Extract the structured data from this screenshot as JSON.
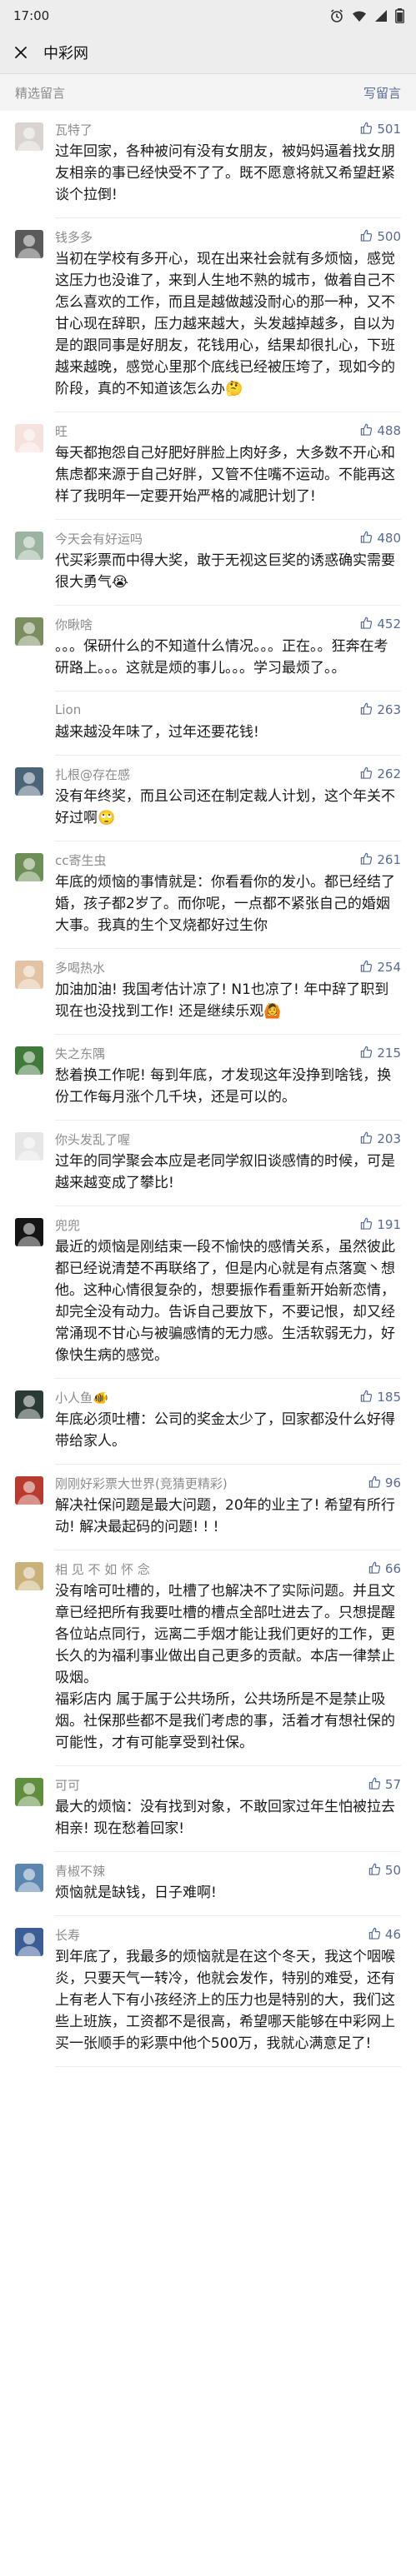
{
  "status_bar": {
    "time": "17:00"
  },
  "nav": {
    "title": "中彩网"
  },
  "section": {
    "title": "精选留言",
    "write_label": "写留言"
  },
  "colors": {
    "link": "#576b95",
    "nickname": "#8c8c8c",
    "background_header": "#ededed"
  },
  "comments": [
    {
      "nickname": "瓦特了",
      "likes": "501",
      "avatar_icon": "cartoon-face-icon",
      "avatar_color": "#d9d4cf",
      "text": "过年回家，各种被问有没有女朋友，被妈妈逼着找女朋友相亲的事已经快受不了了。既不愿意将就又希望赶紧谈个拉倒!"
    },
    {
      "nickname": "钱多多",
      "likes": "500",
      "avatar_icon": "cat-icon",
      "avatar_color": "#5a5a5a",
      "text": "当初在学校有多开心，现在出来社会就有多烦恼，感觉这压力也没谁了，来到人生地不熟的城市，做着自己不怎么喜欢的工作，而且是越做越没耐心的那一种，又不甘心现在辞职，压力越来越大，头发越掉越多，自以为是的跟同事是好朋友，花钱用心，结果却很扎心，下班越来越晚，感觉心里那个底线已经被压垮了，现如今的阶段，真的不知道该怎么办🤔"
    },
    {
      "nickname": "旺",
      "likes": "488",
      "avatar_icon": "maple-leaf-icon",
      "avatar_color": "#f6e2dc",
      "text": "每天都抱怨自己好肥好胖脸上肉好多，大多数不开心和焦虑都来源于自己好胖，又管不住嘴不运动。不能再这样了我明年一定要开始严格的减肥计划了!"
    },
    {
      "nickname": "今天会有好运吗",
      "likes": "480",
      "avatar_icon": "portrait-icon",
      "avatar_color": "#9bb3a0",
      "text": "代买彩票而中得大奖，敢于无视这巨奖的诱惑确实需要很大勇气😭"
    },
    {
      "nickname": "你瞅啥",
      "likes": "452",
      "avatar_icon": "portrait-icon",
      "avatar_color": "#7b8e5f",
      "text": "。。。保研什么的不知道什么情况。。。正在。。狂奔在考研路上。。。这就是烦的事儿。。。学习最烦了。。"
    },
    {
      "nickname": "Lion",
      "likes": "263",
      "avatar_icon": "panda-icon",
      "avatar_color": "#ffffff",
      "text": "越来越没年味了，过年还要花钱!"
    },
    {
      "nickname": "扎根@存在感",
      "likes": "262",
      "avatar_icon": "landscape-icon",
      "avatar_color": "#4a6478",
      "text": "没有年终奖，而且公司还在制定裁人计划，这个年关不好过啊🙄"
    },
    {
      "nickname": "cc寄生虫",
      "likes": "261",
      "avatar_icon": "cartoon-icon",
      "avatar_color": "#6d8f55",
      "text": "年底的烦恼的事情就是：你看看你的发小。都已经结了婚，孩子都2岁了。而你呢，一点都不紧张自己的婚姻大事。我真的生个叉烧都好过生你"
    },
    {
      "nickname": "多喝热水",
      "likes": "254",
      "avatar_icon": "child-icon",
      "avatar_color": "#e3c3a4",
      "text": "加油加油! 我国考估计凉了! N1也凉了! 年中辞了职到现在也没找到工作! 还是继续乐观🙆"
    },
    {
      "nickname": "失之东隅",
      "likes": "215",
      "avatar_icon": "flower-icon",
      "avatar_color": "#3f7a3a",
      "text": "愁着换工作呢! 每到年底，才发现这年没挣到啥钱，换份工作每月涨个几千块，还是可以的。"
    },
    {
      "nickname": "你头发乱了喔",
      "likes": "203",
      "avatar_icon": "sketch-icon",
      "avatar_color": "#e6e6e6",
      "text": "过年的同学聚会本应是老同学叙旧谈感情的时候，可是越来越变成了攀比!"
    },
    {
      "nickname": "兜兜",
      "likes": "191",
      "avatar_icon": "dark-portrait-icon",
      "avatar_color": "#151515",
      "text": "最近的烦恼是刚结束一段不愉快的感情关系，虽然彼此都已经说清楚不再联络了，但是内心就是有点落寞丶想他。这种心情很复杂的，想要振作看重新开始新恋情，却完全没有动力。告诉自己要放下，不要记恨，却又经常涌现不甘心与被骗感情的无力感。生活软弱无力，好像快生病的感觉。"
    },
    {
      "nickname": "小人鱼🐠",
      "likes": "185",
      "avatar_icon": "mermaid-icon",
      "avatar_color": "#2b3a34",
      "text": "年底必须吐槽：公司的奖金太少了，回家都没什么好得带给家人。"
    },
    {
      "nickname": "刚刚好彩票大世界(竞猜更精彩)",
      "likes": "96",
      "avatar_icon": "shop-icon",
      "avatar_color": "#b93a2e",
      "text": "解决社保问题是最大问题，20年的业主了! 希望有所行动! 解决最起码的问题! ! !"
    },
    {
      "nickname": "相 见 不 如 怀 念",
      "likes": "66",
      "avatar_icon": "collage-icon",
      "avatar_color": "#c9b27a",
      "text": "没有啥可吐槽的，吐槽了也解决不了实际问题。并且文章已经把所有我要吐槽的槽点全部吐进去了。只想提醒各位站点同行，远离二手烟才能让我们更好的工作，更长久的为福利事业做出自己更多的贡献。本店一律禁止吸烟。\n福彩店内 属于属于公共场所，公共场所是不是禁止吸烟。社保那些都不是我们考虑的事，活着才有想社保的可能性，才有可能享受到社保。"
    },
    {
      "nickname": "可可",
      "likes": "57",
      "avatar_icon": "grass-icon",
      "avatar_color": "#5f8f3d",
      "text": "最大的烦恼：没有找到对象，不敢回家过年生怕被拉去相亲! 现在愁着回家!"
    },
    {
      "nickname": "青椒不辣",
      "likes": "50",
      "avatar_icon": "wave-icon",
      "avatar_color": "#5a86b0",
      "text": "烦恼就是缺钱，日子难啊!"
    },
    {
      "nickname": "长寿",
      "likes": "46",
      "avatar_icon": "bird-icon",
      "avatar_color": "#3b5d96",
      "text": "到年底了，我最多的烦恼就是在这个冬天，我这个咽喉炎，只要天气一转冷，他就会发作，特别的难受，还有上有老人下有小孩经济上的压力也是特别的大，我们这些上班族，工资都不是很高，希望哪天能够在中彩网上买一张顺手的彩票中他个500万，我就心满意足了!"
    }
  ]
}
